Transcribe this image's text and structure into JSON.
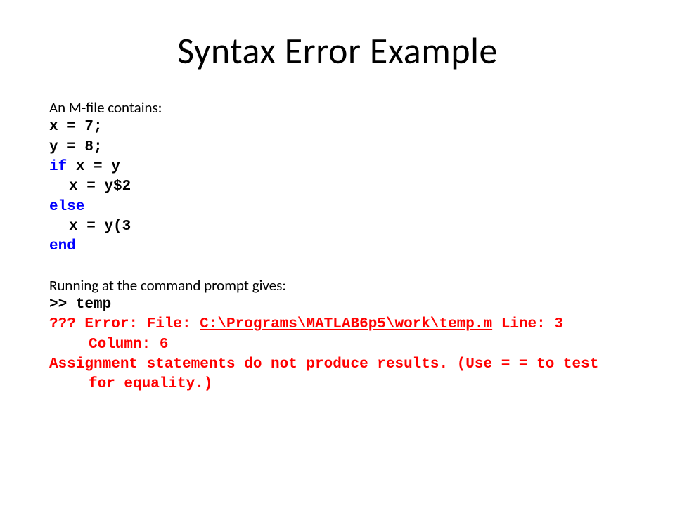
{
  "title": "Syntax Error Example",
  "intro": "An M-file contains:",
  "code": {
    "l1": "x = 7;",
    "l2": "y = 8;",
    "l3_kw": "if",
    "l3_rest": " x = y",
    "l4": "x = y$2",
    "l5_kw": "else",
    "l6": "x = y(3",
    "l7_kw": "end"
  },
  "run_label": "Running at the command prompt gives:",
  "prompt": ">> temp",
  "error": {
    "prefix": "??? Error: File: ",
    "path": "C:\\Programs\\MATLAB6p5\\work\\temp.m",
    "suffix": " Line: 3 Column: 6",
    "msg": "Assignment statements do not produce results. (Use = = to test for equality.)"
  }
}
